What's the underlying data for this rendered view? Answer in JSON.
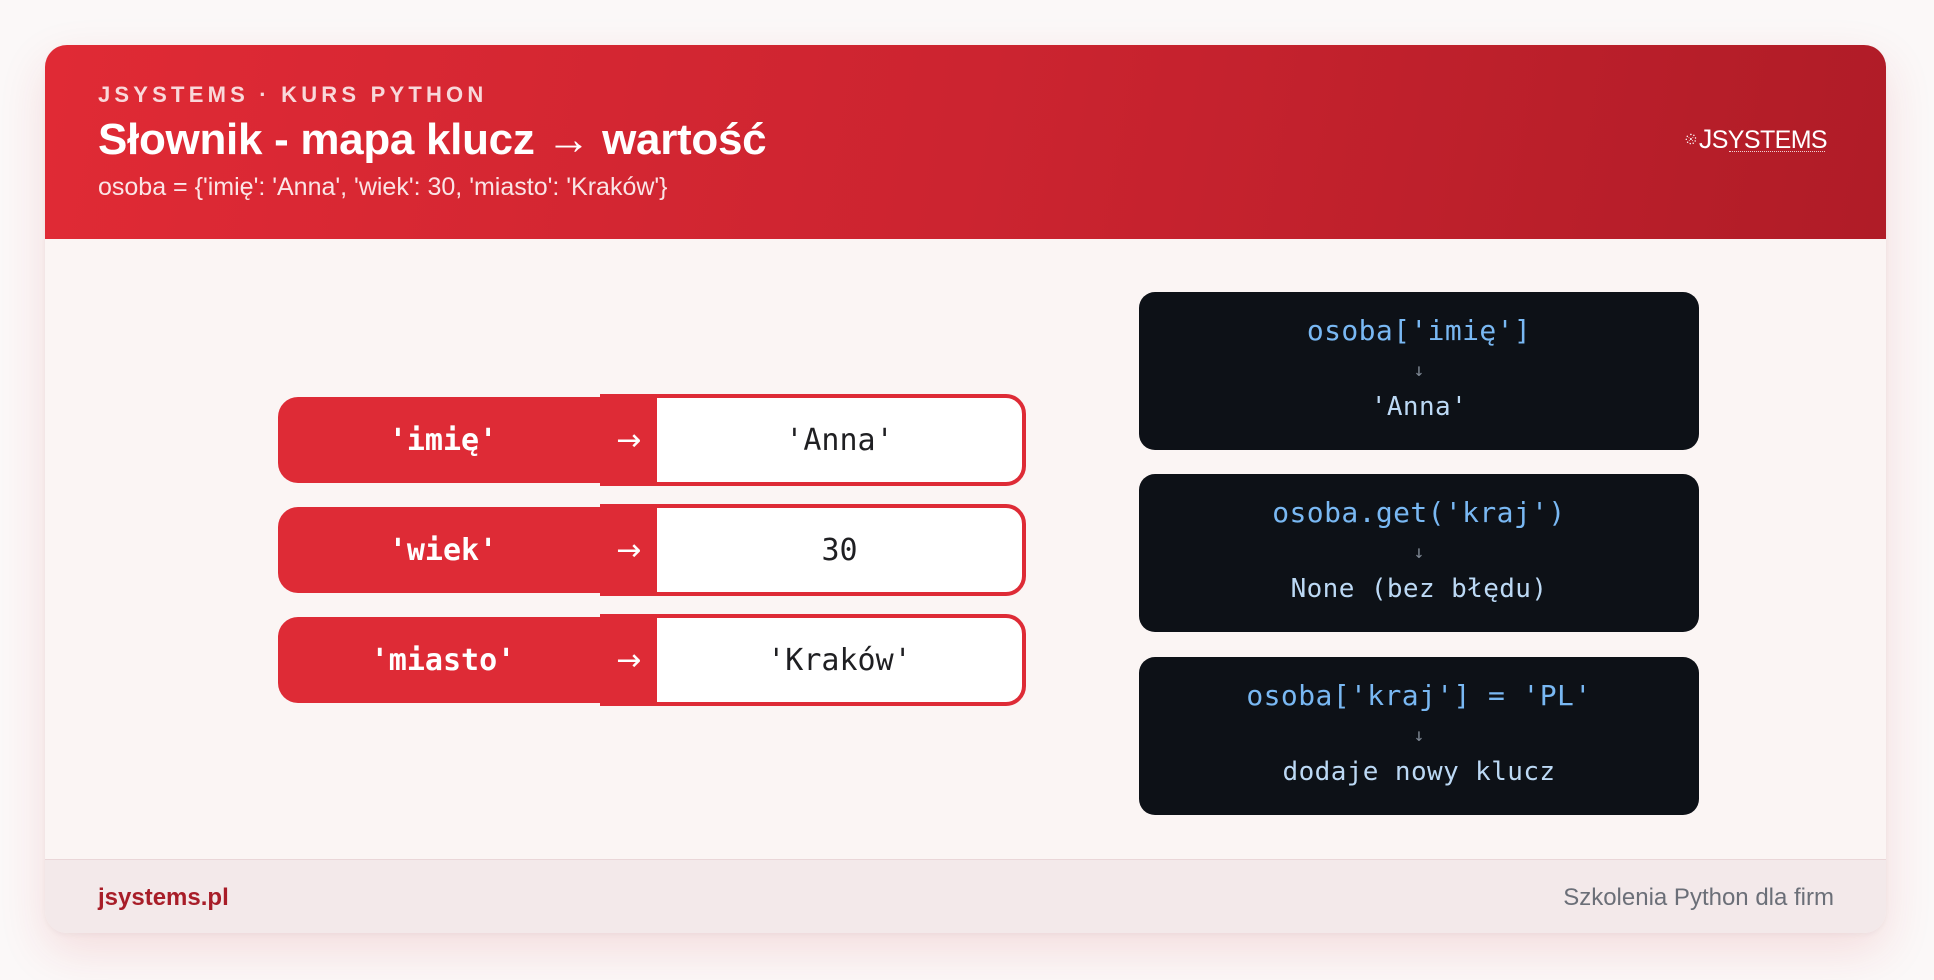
{
  "header": {
    "eyebrow": "JSYSTEMS · KURS PYTHON",
    "title": "Słownik - mapa klucz → wartość",
    "subtitle": "osoba = {'imię': 'Anna', 'wiek': 30, 'miasto': 'Kraków'}",
    "logo": {
      "text": "JSYSTEMS",
      "icon": "jsystems-logo-icon"
    }
  },
  "pairs": [
    {
      "key": "'imię'",
      "arrow": "→",
      "value": "'Anna'"
    },
    {
      "key": "'wiek'",
      "arrow": "→",
      "value": "30"
    },
    {
      "key": "'miasto'",
      "arrow": "→",
      "value": "'Kraków'"
    }
  ],
  "examples": [
    {
      "expr": "osoba['imię']",
      "arrow": "↓",
      "result": "'Anna'"
    },
    {
      "expr": "osoba.get('kraj')",
      "arrow": "↓",
      "result": "None (bez błędu)"
    },
    {
      "expr": "osoba['kraj'] = 'PL'",
      "arrow": "↓",
      "result": "dodaje nowy klucz"
    }
  ],
  "footer": {
    "site": "jsystems.pl",
    "tagline": "Szkolenia Python dla firm"
  },
  "colors": {
    "accent": "#de2b36",
    "header_dark": "#b01c27",
    "code_bg": "#0d1117",
    "code_expr": "#79b8f3",
    "footer_site": "#a81d28"
  }
}
